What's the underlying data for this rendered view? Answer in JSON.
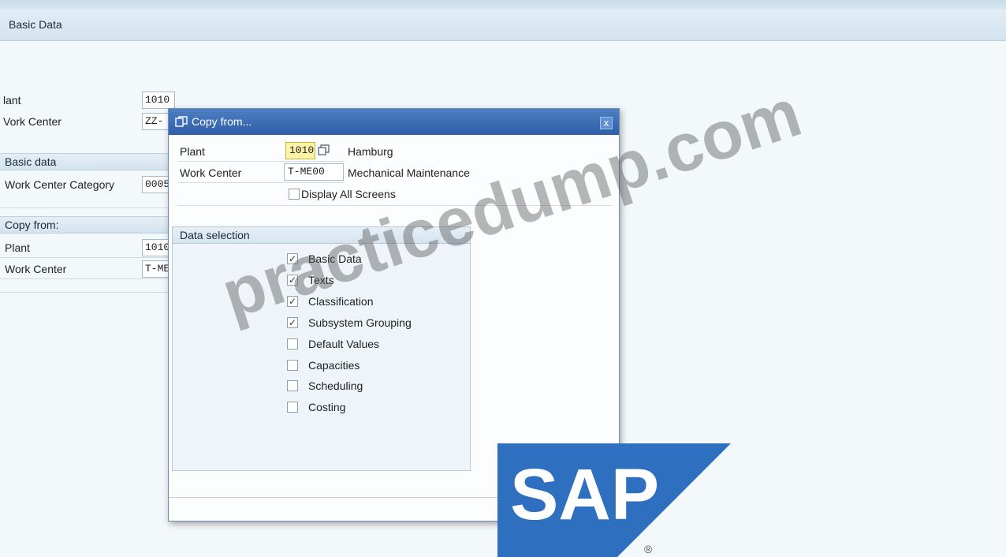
{
  "screen": {
    "title": "Basic Data"
  },
  "background": {
    "plant_label": "lant",
    "plant_value": "1010",
    "work_center_label": "Vork Center",
    "work_center_value": "ZZ-",
    "section_basic_data": "Basic data",
    "work_center_category_label": "Work Center Category",
    "work_center_category_value": "0005",
    "section_copy_from": "Copy from:",
    "copy_plant_label": "Plant",
    "copy_plant_value": "1010",
    "copy_work_center_label": "Work Center",
    "copy_work_center_value": "T-ME"
  },
  "dialog": {
    "title": "Copy from...",
    "close_label": "x",
    "plant_label": "Plant",
    "plant_value": "1010",
    "plant_text": "Hamburg",
    "work_center_label": "Work Center",
    "work_center_value": "T-ME00",
    "work_center_text": "Mechanical Maintenance",
    "display_all_label": "Display All Screens",
    "display_all_checked": false,
    "data_selection_title": "Data selection",
    "options": [
      {
        "label": "Basic Data",
        "checked": true
      },
      {
        "label": "Texts",
        "checked": true
      },
      {
        "label": "Classification",
        "checked": true
      },
      {
        "label": "Subsystem Grouping",
        "checked": true
      },
      {
        "label": "Default Values",
        "checked": false
      },
      {
        "label": "Capacities",
        "checked": false
      },
      {
        "label": "Scheduling",
        "checked": false
      },
      {
        "label": "Costing",
        "checked": false
      }
    ]
  },
  "overlay": {
    "watermark": "practicedump.com",
    "logo_text": "SAP",
    "logo_registered": "®",
    "brand_color": "#2f6fbf"
  }
}
